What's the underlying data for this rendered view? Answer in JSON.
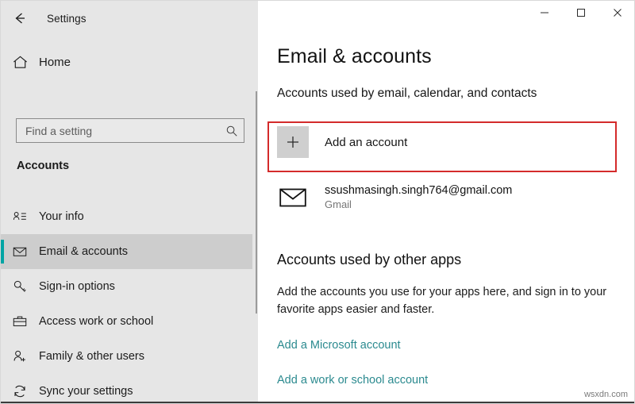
{
  "window": {
    "title": "Settings",
    "back_icon": "back-arrow-icon",
    "controls": {
      "minimize": "–",
      "maximize": "□",
      "close": "✕"
    }
  },
  "sidebar": {
    "home_label": "Home",
    "home_icon": "home-icon",
    "search": {
      "placeholder": "Find a setting",
      "value": "",
      "icon": "search-icon"
    },
    "section_heading": "Accounts",
    "items": [
      {
        "label": "Your info",
        "icon": "contact-card-icon",
        "selected": false
      },
      {
        "label": "Email & accounts",
        "icon": "envelope-icon",
        "selected": true
      },
      {
        "label": "Sign-in options",
        "icon": "key-icon",
        "selected": false
      },
      {
        "label": "Access work or school",
        "icon": "briefcase-icon",
        "selected": false
      },
      {
        "label": "Family & other users",
        "icon": "person-add-icon",
        "selected": false
      },
      {
        "label": "Sync your settings",
        "icon": "sync-icon",
        "selected": false
      }
    ]
  },
  "main": {
    "page_title": "Email & accounts",
    "section_email_accounts": {
      "heading": "Accounts used by email, calendar, and contacts",
      "add_account": {
        "label": "Add an account",
        "icon": "plus-icon",
        "highlighted": true
      },
      "accounts": [
        {
          "email": "ssushmasingh.singh764@gmail.com",
          "provider": "Gmail",
          "icon": "envelope-icon"
        }
      ]
    },
    "section_other_apps": {
      "heading": "Accounts used by other apps",
      "description": "Add the accounts you use for your apps here, and sign in to your favorite apps easier and faster.",
      "links": [
        {
          "label": "Add a Microsoft account"
        },
        {
          "label": "Add a work or school account"
        }
      ]
    }
  },
  "annotation": {
    "highlight_color": "#d42b2b"
  },
  "watermark": {
    "text": "wsxdn.com"
  }
}
